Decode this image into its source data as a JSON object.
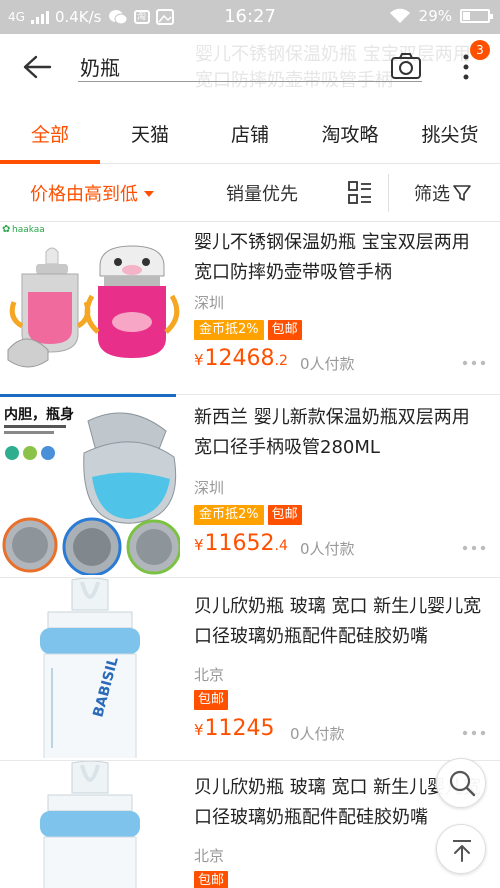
{
  "status_bar": {
    "network": "4G",
    "speed": "0.4K/s",
    "time": "16:27",
    "battery": "29%"
  },
  "search": {
    "query": "奶瓶",
    "ghost_title": "婴儿不锈钢保温奶瓶 宝宝双层两用宽口防摔奶壶带吸管手柄",
    "badge_count": "3"
  },
  "tabs": [
    {
      "label": "全部",
      "active": true
    },
    {
      "label": "天猫",
      "active": false
    },
    {
      "label": "店铺",
      "active": false
    },
    {
      "label": "淘攻略",
      "active": false
    },
    {
      "label": "挑尖货",
      "active": false
    }
  ],
  "sortbar": {
    "price_sort": "价格由高到低",
    "sales_sort": "销量优先",
    "filter": "筛选"
  },
  "products": [
    {
      "title": "婴儿不锈钢保温奶瓶 宝宝双层两用宽口防摔奶壶带吸管手柄",
      "location": "深圳",
      "tags": [
        "金币抵2%",
        "包邮"
      ],
      "price_currency": "¥",
      "price_int": "12468",
      "price_dec": ".2",
      "paid": "0人付款",
      "thumb_brand": "haakaa"
    },
    {
      "title": "新西兰 婴儿新款保温奶瓶双层两用宽口径手柄吸管280ML",
      "location": "深圳",
      "tags": [
        "金币抵2%",
        "包邮"
      ],
      "price_currency": "¥",
      "price_int": "11652",
      "price_dec": ".4",
      "paid": "0人付款",
      "thumb_caption": "内胆，瓶身"
    },
    {
      "title": "贝儿欣奶瓶 玻璃 宽口 新生儿婴儿宽口径玻璃奶瓶配件配硅胶奶嘴",
      "location": "北京",
      "tags": [
        "包邮"
      ],
      "price_currency": "¥",
      "price_int": "11245",
      "price_dec": "",
      "paid": "0人付款",
      "thumb_brand": "BABISIL"
    },
    {
      "title": "贝儿欣奶瓶 玻璃 宽口 新生儿婴儿宽口径玻璃奶瓶配件配硅胶奶嘴",
      "location": "北京",
      "tags": [
        "包邮"
      ]
    }
  ],
  "colors": {
    "accent": "#ff5000",
    "coin_tag": "#ffa200",
    "muted": "#999999",
    "status_bar": "#c9c9c9"
  },
  "icons": [
    "back-arrow-icon",
    "camera-icon",
    "more-vertical-icon",
    "list-view-icon",
    "filter-funnel-icon",
    "image-search-icon",
    "back-to-top-icon"
  ]
}
